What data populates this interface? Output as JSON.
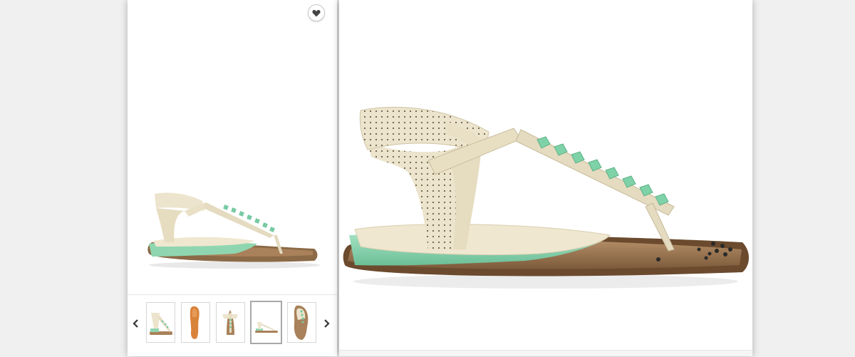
{
  "gallery": {
    "favorite_icon": "heart-icon",
    "prev_icon": "chevron-left-icon",
    "next_icon": "chevron-right-icon",
    "thumbnails": [
      {
        "view": "side-angle"
      },
      {
        "view": "sole"
      },
      {
        "view": "front"
      },
      {
        "view": "side-small",
        "active": true
      },
      {
        "view": "top"
      }
    ]
  },
  "colors": {
    "cream": "#ece4cc",
    "mint": "#8fd6b0",
    "sole": "#a9815a",
    "background": "#f0f0f0"
  }
}
